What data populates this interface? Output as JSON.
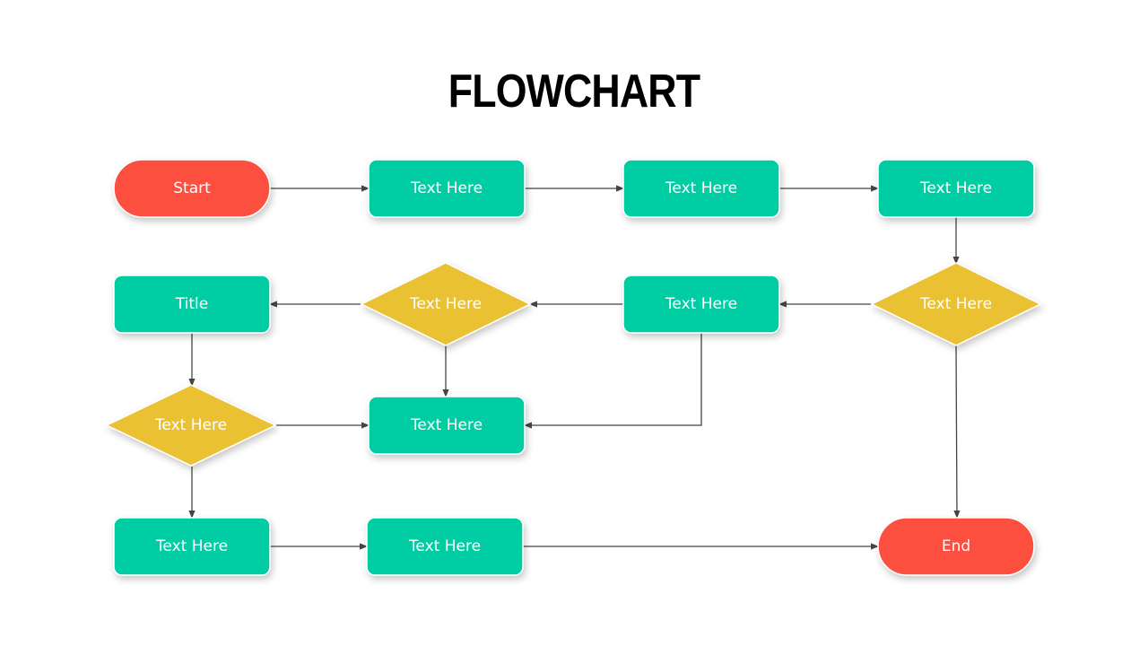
{
  "title": "FLOWCHART",
  "colors": {
    "terminal": "#fd4f3f",
    "process": "#03cda3",
    "decision": "#e9c132",
    "connector": "#444444"
  },
  "nodes": {
    "start": {
      "label": "Start",
      "type": "terminal"
    },
    "p1": {
      "label": "Text Here",
      "type": "process"
    },
    "p2": {
      "label": "Text Here",
      "type": "process"
    },
    "p3": {
      "label": "Text Here",
      "type": "process"
    },
    "d2": {
      "label": "Text Here",
      "type": "decision"
    },
    "p4": {
      "label": "Text Here",
      "type": "process"
    },
    "d1": {
      "label": "Text Here",
      "type": "decision"
    },
    "title_box": {
      "label": "Title",
      "type": "process"
    },
    "d3": {
      "label": "Text Here",
      "type": "decision"
    },
    "p5": {
      "label": "Text Here",
      "type": "process"
    },
    "p6": {
      "label": "Text Here",
      "type": "process"
    },
    "p7": {
      "label": "Text Here",
      "type": "process"
    },
    "end": {
      "label": "End",
      "type": "terminal"
    }
  },
  "edges": [
    {
      "from": "start",
      "to": "p1"
    },
    {
      "from": "p1",
      "to": "p2"
    },
    {
      "from": "p2",
      "to": "p3"
    },
    {
      "from": "p3",
      "to": "d2"
    },
    {
      "from": "d2",
      "to": "p4"
    },
    {
      "from": "p4",
      "to": "d1"
    },
    {
      "from": "d1",
      "to": "title_box"
    },
    {
      "from": "d1",
      "to": "p5"
    },
    {
      "from": "p4",
      "to": "p5"
    },
    {
      "from": "title_box",
      "to": "d3"
    },
    {
      "from": "d3",
      "to": "p5"
    },
    {
      "from": "d3",
      "to": "p6"
    },
    {
      "from": "p6",
      "to": "p7"
    },
    {
      "from": "p7",
      "to": "end"
    },
    {
      "from": "d2",
      "to": "end"
    }
  ]
}
